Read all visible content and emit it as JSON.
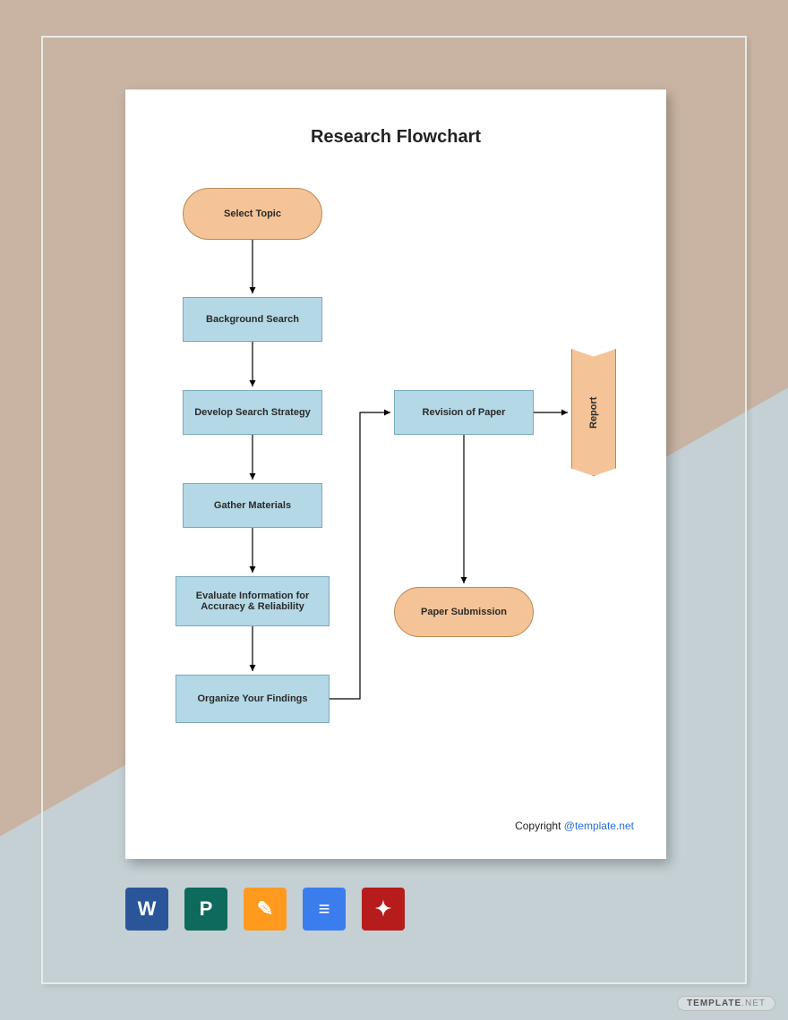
{
  "title": "Research Flowchart",
  "nodes": {
    "select_topic": "Select Topic",
    "background_search": "Background Search",
    "develop_strategy": "Develop Search Strategy",
    "gather_materials": "Gather Materials",
    "evaluate_info": "Evaluate Information for Accuracy & Reliability",
    "organize_findings": "Organize Your Findings",
    "revision": "Revision of Paper",
    "submission": "Paper Submission",
    "report": "Report"
  },
  "copyright": {
    "prefix": "Copyright ",
    "link": "@template.net"
  },
  "icons": {
    "word": "W",
    "publisher": "P",
    "pages": "✎",
    "docs": "≡",
    "pdf": "✦"
  },
  "watermark": {
    "brand": "TEMPLATE",
    "suffix": ".NET"
  }
}
